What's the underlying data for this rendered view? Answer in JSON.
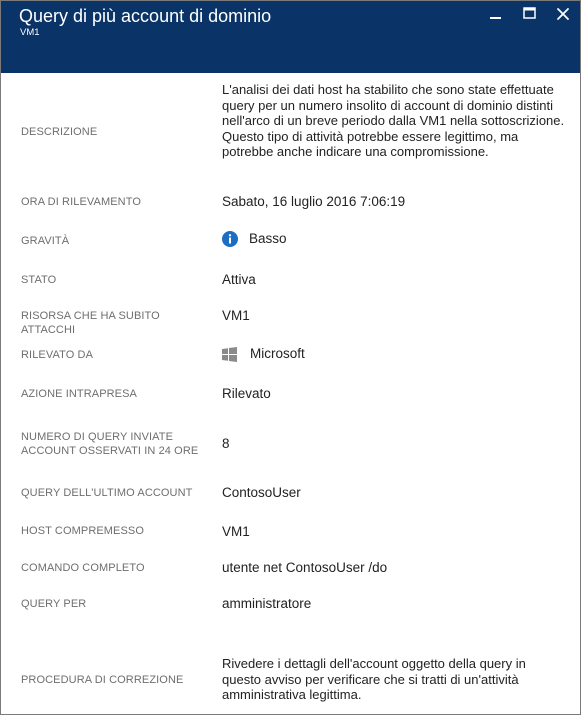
{
  "header": {
    "title": "Query di più account di dominio",
    "subtitle": "VM1"
  },
  "window_controls": {
    "minimize_icon": "minimize-icon",
    "maximize_icon": "maximize-icon",
    "close_icon": "close-icon"
  },
  "details": {
    "descrizione": {
      "label": "DESCRIZIONE",
      "value": "L'analisi dei dati host ha stabilito che sono state effettuate query per un numero insolito di account di dominio distinti nell'arco di un breve periodo dalla VM1 nella sottoscrizione. Questo tipo di attività potrebbe essere legittimo, ma potrebbe anche indicare una compromissione."
    },
    "ora": {
      "label": "ORA DI RILEVAMENTO",
      "value": "Sabato, 16 luglio 2016 7:06:19"
    },
    "gravita": {
      "label": "GRAVITÀ",
      "value": "Basso",
      "icon": "info-icon",
      "icon_color": "#1b6ec2"
    },
    "stato": {
      "label": "STATO",
      "value": "Attiva"
    },
    "risorsa": {
      "label": "RISORSA CHE HA SUBITO ATTACCHI",
      "value": "VM1"
    },
    "rilevato_da": {
      "label": "RILEVATO DA",
      "value": "Microsoft",
      "icon": "windows-logo-icon",
      "icon_color": "#8a8a8a"
    },
    "azione": {
      "label": "AZIONE INTRAPRESA",
      "value": "Rilevato"
    },
    "numero_query": {
      "label_line1": "NUMERO DI QUERY INVIATE",
      "label_line2": "ACCOUNT OSSERVATI IN 24 ORE",
      "value": "8"
    },
    "ultimo_account": {
      "label": "QUERY DELL'ULTIMO ACCOUNT",
      "value": "ContosoUser"
    },
    "host": {
      "label": "HOST COMPREMESSO",
      "value": "VM1"
    },
    "comando": {
      "label": "COMANDO COMPLETO",
      "value": "utente net ContosoUser /do"
    },
    "query_per": {
      "label": "QUERY PER",
      "value": "amministratore"
    },
    "procedura": {
      "label": "PROCEDURA DI CORREZIONE",
      "value": "Rivedere i dettagli dell'account oggetto della query in questo avviso per verificare che si tratti di un'attività amministrativa legittima."
    }
  }
}
